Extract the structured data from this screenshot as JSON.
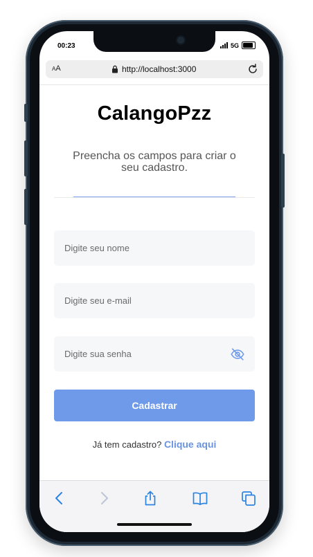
{
  "status_bar": {
    "time": "00:23",
    "network": "5G",
    "battery_level": 0.85
  },
  "browser": {
    "text_size_small": "A",
    "text_size_large": "A",
    "url": "http://localhost:3000"
  },
  "page": {
    "title": "CalangoPzz",
    "subtitle": "Preencha os campos para criar o seu cadastro."
  },
  "form": {
    "name_placeholder": "Digite seu nome",
    "email_placeholder": "Digite seu e-mail",
    "password_placeholder": "Digite sua senha",
    "submit_label": "Cadastrar",
    "login_prompt": "Já tem cadastro?",
    "login_link": "Clique aqui"
  },
  "colors": {
    "accent": "#6e9ae9",
    "link": "#6a94df",
    "field_background": "#f6f7f9",
    "toolbar_icon": "#2a83e0"
  },
  "icons": {
    "lock": "lock-icon",
    "reload": "reload-icon",
    "password_visibility": "eye-off-icon",
    "back": "chevron-left-icon",
    "forward": "chevron-right-icon",
    "share": "share-icon",
    "bookmarks": "book-icon",
    "tabs": "tabs-icon"
  }
}
